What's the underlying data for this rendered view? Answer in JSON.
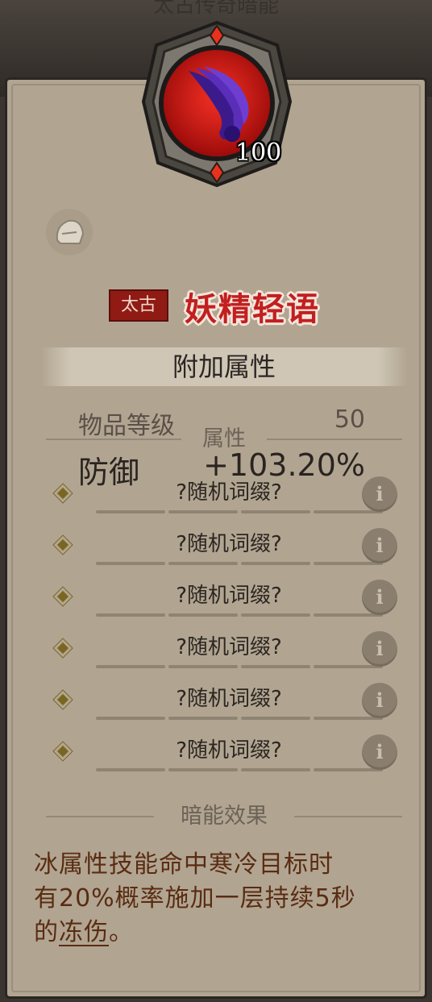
{
  "header": {
    "title": "太古传奇暗能"
  },
  "item": {
    "level": "100",
    "tier": "太古",
    "name": "妖精轻语"
  },
  "attributes_section": {
    "title": "附加属性",
    "item_level_label": "物品等级",
    "item_level_value": "50",
    "defense_label": "防御",
    "defense_value": "+103.20%"
  },
  "properties_section": {
    "title": "属性",
    "affixes": [
      {
        "label": "?随机词缀?"
      },
      {
        "label": "?随机词缀?"
      },
      {
        "label": "?随机词缀?"
      },
      {
        "label": "?随机词缀?"
      },
      {
        "label": "?随机词缀?"
      },
      {
        "label": "?随机词缀?"
      }
    ],
    "info_glyph": "i"
  },
  "dark_energy_section": {
    "title": "暗能效果",
    "line1": "冰属性技能命中寒冷目标时",
    "line2": "有20%概率施加一层持续5秒",
    "line3_prefix": "的",
    "line3_link": "冻伤",
    "line3_suffix": "。"
  },
  "colors": {
    "panel": "#b1a592",
    "item_name": "#c21f1f",
    "tier_badge": "#8f1b14",
    "effect_text": "#5a2c12"
  },
  "icons": [
    "helmet-icon",
    "item-art-icon",
    "info-icon",
    "diamond-bullet-icon"
  ]
}
